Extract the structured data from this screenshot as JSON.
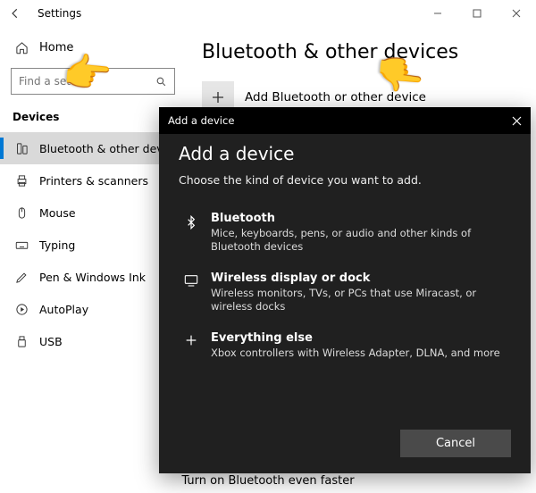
{
  "window": {
    "title": "Settings"
  },
  "sidebar": {
    "home": "Home",
    "search_placeholder": "Find a setting",
    "section": "Devices",
    "items": [
      {
        "label": "Bluetooth & other devices",
        "selected": true
      },
      {
        "label": "Printers & scanners"
      },
      {
        "label": "Mouse"
      },
      {
        "label": "Typing"
      },
      {
        "label": "Pen & Windows Ink"
      },
      {
        "label": "AutoPlay"
      },
      {
        "label": "USB"
      }
    ]
  },
  "main": {
    "title": "Bluetooth & other devices",
    "add_label": "Add Bluetooth or other device",
    "footer_hint": "Turn on Bluetooth even faster"
  },
  "dialog": {
    "window_title": "Add a device",
    "heading": "Add a device",
    "subheading": "Choose the kind of device you want to add.",
    "options": [
      {
        "title": "Bluetooth",
        "desc": "Mice, keyboards, pens, or audio and other kinds of Bluetooth devices"
      },
      {
        "title": "Wireless display or dock",
        "desc": "Wireless monitors, TVs, or PCs that use Miracast, or wireless docks"
      },
      {
        "title": "Everything else",
        "desc": "Xbox controllers with Wireless Adapter, DLNA, and more"
      }
    ],
    "cancel": "Cancel"
  }
}
